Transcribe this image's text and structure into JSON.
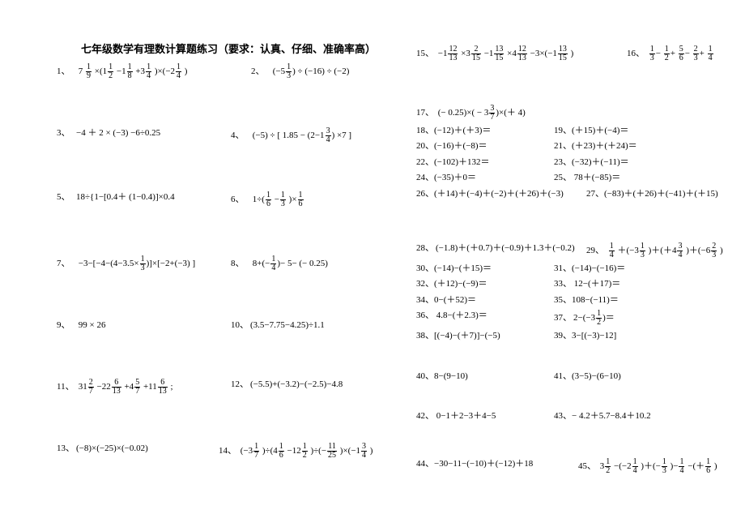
{
  "title": "七年级数学有理数计算题练习（要求：认真、仔细、准确率高）",
  "left": {
    "r1a_num": "1、",
    "r1a_pre": "7",
    "r1a_f1n": "1",
    "r1a_f1d": "9",
    "r1a_t1": "×(1",
    "r1a_f2n": "1",
    "r1a_f2d": "2",
    "r1a_t2": "−1",
    "r1a_f3n": "1",
    "r1a_f3d": "8",
    "r1a_t3": "+3",
    "r1a_f4n": "1",
    "r1a_f4d": "4",
    "r1a_t4": ")×(−2",
    "r1a_f5n": "1",
    "r1a_f5d": "4",
    "r1a_t5": ")",
    "r1b_num": "2、",
    "r1b_t1": "(−5",
    "r1b_fn": "1",
    "r1b_fd": "3",
    "r1b_t2": ") ÷ (−16) ÷ (−2)",
    "r2a_num": "3、",
    "r2a": "−4 ＋ 2 × (−3) −6÷0.25",
    "r2b_num": "4、",
    "r2b_t1": "(−5) ÷ [ 1.85 − (2−1",
    "r2b_fn": "3",
    "r2b_fd": "4",
    "r2b_t2": ") ×7 ]",
    "r3a_num": "5、",
    "r3a": "18÷{1−[0.4＋ (1−0.4)]×0.4",
    "r3b_num": "6、",
    "r3b_t1": "1÷(",
    "r3b_f1n": "1",
    "r3b_f1d": "6",
    "r3b_t2": "−",
    "r3b_f2n": "1",
    "r3b_f2d": "3",
    "r3b_t3": ")×",
    "r3b_f3n": "1",
    "r3b_f3d": "6",
    "r4a_num": "7、",
    "r4a_t1": "−3−[−4−(4−3.5×",
    "r4a_fn": "1",
    "r4a_fd": "3",
    "r4a_t2": ")]×[−2+(−3) ]",
    "r4b_num": "8、",
    "r4b_t1": "8+(−",
    "r4b_fn": "1",
    "r4b_fd": "4",
    "r4b_t2": ")− 5− (− 0.25)",
    "r5a_num": "9、",
    "r5a": "  99 × 26",
    "r5b_num": "10、",
    "r5b": "(3.5−7.75−4.25)÷1.1",
    "r6a_num": "11、",
    "r6a_p1": "31",
    "r6a_f1n": "2",
    "r6a_f1d": "7",
    "r6a_p2": "−22",
    "r6a_f2n": "6",
    "r6a_f2d": "13",
    "r6a_p3": "+4",
    "r6a_f3n": "5",
    "r6a_f3d": "7",
    "r6a_p4": "+11",
    "r6a_f4n": "6",
    "r6a_f4d": "13",
    "r6a_p5": ";",
    "r6b_num": "12、",
    "r6b": "(−5.5)+(−3.2)−(−2.5)−4.8",
    "r7a_num": "13、",
    "r7a": "(−8)×(−25)×(−0.02)",
    "r7b_num": "14、",
    "r7b_p1": "(−3",
    "r7b_f1n": "1",
    "r7b_f1d": "7",
    "r7b_p2": ")÷(4",
    "r7b_f2n": "1",
    "r7b_f2d": "6",
    "r7b_p3": "−12",
    "r7b_f3n": "1",
    "r7b_f3d": "2",
    "r7b_p4": ")÷(−",
    "r7b_f4n": "11",
    "r7b_f4d": "25",
    "r7b_p5": ")×(−1",
    "r7b_f5n": "3",
    "r7b_f5d": "4",
    "r7b_p6": ")"
  },
  "right": {
    "r15_num": "15、",
    "r15_p1": "−1",
    "r15_f1n": "12",
    "r15_f1d": "13",
    "r15_p2": "×3",
    "r15_f2n": "2",
    "r15_f2d": "15",
    "r15_p3": "−1",
    "r15_f3n": "13",
    "r15_f3d": "15",
    "r15_p4": "×4",
    "r15_f4n": "12",
    "r15_f4d": "13",
    "r15_p5": "−3×(−1",
    "r15_f5n": "13",
    "r15_f5d": "15",
    "r15_p6": ")",
    "r16_num": "16、",
    "r16_f1n": "1",
    "r16_f1d": "3",
    "r16_p1": "−",
    "r16_f2n": "1",
    "r16_f2d": "2",
    "r16_p2": "+",
    "r16_f3n": "5",
    "r16_f3d": "6",
    "r16_p3": "−",
    "r16_f4n": "2",
    "r16_f4d": "3",
    "r16_p4": "+",
    "r16_f5n": "1",
    "r16_f5d": "4",
    "r17_num": "17、",
    "r17_p1": "(− 0.25)×( − 3",
    "r17_fn": "3",
    "r17_fd": "7",
    "r17_p2": ")×(＋ 4)",
    "r18": "18、(−12)＋(＋3)＝",
    "r19": "19、(＋15)＋(−4)＝",
    "r20": "20、(−16)＋(−8)＝",
    "r21": "21、(＋23)＋(＋24)＝",
    "r22": "22、(−102)＋132＝",
    "r23": "23、(−32)＋(−11)＝",
    "r24": "24、(−35)＋0＝",
    "r25": "25、 78＋(−85)＝",
    "r26": "26、(＋14)＋(−4)＋(−2)＋(＋26)＋(−3)",
    "r27": "27、(−83)＋(＋26)＋(−41)＋(＋15)",
    "r28_num": "28、",
    "r28": "(−1.8)＋(＋0.7)＋(−0.9)＋1.3＋(−0.2)",
    "r29_num": "29、",
    "r29_f1n": "1",
    "r29_f1d": "4",
    "r29_p1": "＋(−3",
    "r29_f2n": "1",
    "r29_f2d": "3",
    "r29_p2": ")＋(＋4",
    "r29_f3n": "3",
    "r29_f3d": "4",
    "r29_p3": ")＋(−6",
    "r29_f4n": "2",
    "r29_f4d": "3",
    "r29_p4": ")",
    "r30": "30、(−14)−(＋15)＝",
    "r31": "31、(−14)−(−16)＝",
    "r32": "32、(＋12)−(−9)＝",
    "r33": "33、 12−(＋17)＝",
    "r34": "34、0−(＋52)＝",
    "r35": "35、108−(−11)＝",
    "r36": "36、 4.8−(＋2.3)＝",
    "r37_num": "37、",
    "r37_p1": "2−(−3",
    "r37_fn": "1",
    "r37_fd": "2",
    "r37_p2": ")＝",
    "r38": "38、[(−4)−(＋7)]−(−5)",
    "r39": "39、3−[(−3)−12]",
    "r40": "40、8−(9−10)",
    "r41": "41、(3−5)−(6−10)",
    "r42": "42、 0−1＋2−3＋4−5",
    "r43": "43、− 4.2＋5.7−8.4＋10.2",
    "r44": "44、−30−11−(−10)＋(−12)＋18",
    "r45_num": "45、",
    "r45_p1": "3",
    "r45_f1n": "1",
    "r45_f1d": "2",
    "r45_p2": "−(−2",
    "r45_f2n": "1",
    "r45_f2d": "4",
    "r45_p3": ")＋(−",
    "r45_f3n": "1",
    "r45_f3d": "3",
    "r45_p4": ")−",
    "r45_f4n": "1",
    "r45_f4d": "4",
    "r45_p5": "−(＋",
    "r45_f5n": "1",
    "r45_f5d": "6",
    "r45_p6": ")"
  }
}
